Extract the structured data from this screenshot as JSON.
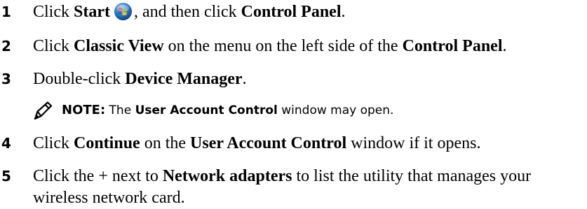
{
  "steps": [
    {
      "number": "1",
      "parts": [
        {
          "text": "Click ",
          "bold": false
        },
        {
          "text": "Start",
          "bold": true
        },
        {
          "icon": "windows-start-orb-icon"
        },
        {
          "text": ", and then click ",
          "bold": false
        },
        {
          "text": "Control Panel",
          "bold": true
        },
        {
          "text": ".",
          "bold": false
        }
      ]
    },
    {
      "number": "2",
      "parts": [
        {
          "text": "Click ",
          "bold": false
        },
        {
          "text": "Classic View",
          "bold": true
        },
        {
          "text": " on the menu on the left side of the ",
          "bold": false
        },
        {
          "text": "Control Panel",
          "bold": true
        },
        {
          "text": ".",
          "bold": false
        }
      ]
    },
    {
      "number": "3",
      "parts": [
        {
          "text": "Double-click ",
          "bold": false
        },
        {
          "text": "Device Manager",
          "bold": true
        },
        {
          "text": ".",
          "bold": false
        }
      ]
    },
    {
      "number": "4",
      "parts": [
        {
          "text": "Click ",
          "bold": false
        },
        {
          "text": "Continue",
          "bold": true
        },
        {
          "text": " on the ",
          "bold": false
        },
        {
          "text": "User Account Control",
          "bold": true
        },
        {
          "text": " window if it opens.",
          "bold": false
        }
      ]
    },
    {
      "number": "5",
      "parts": [
        {
          "text": "Click the + next to ",
          "bold": false
        },
        {
          "text": "Network adapters",
          "bold": true
        },
        {
          "text": " to list the utility that manages your wireless network card.",
          "bold": false
        }
      ]
    }
  ],
  "note": {
    "icon": "pencil-note-icon",
    "label": "NOTE:",
    "parts": [
      {
        "text": " The ",
        "bold": false
      },
      {
        "text": "User Account Control",
        "bold": true
      },
      {
        "text": " window may open.",
        "bold": false
      }
    ]
  },
  "colors": {
    "text": "#000000",
    "orb_blue": "#1e6fc9",
    "orb_red": "#e8432a",
    "orb_green": "#5cb83a",
    "orb_yellow": "#f7c21a"
  }
}
